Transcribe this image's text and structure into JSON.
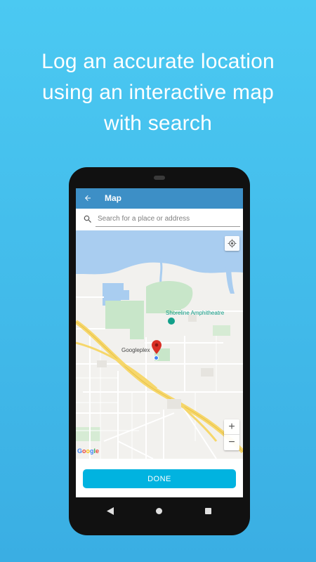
{
  "headline": {
    "line1": "Log an accurate location",
    "line2": "using an interactive map",
    "line3": "with search"
  },
  "appbar": {
    "back_icon": "arrow-left-icon",
    "title": "Map"
  },
  "search": {
    "icon": "search-icon",
    "placeholder": "Search for a place or address",
    "value": ""
  },
  "map": {
    "labels": {
      "shoreline": "Shoreline Amphitheatre",
      "googleplex": "Googleplex"
    },
    "logo": {
      "g1": "G",
      "o1": "o",
      "o2": "o",
      "g2": "g",
      "l": "l",
      "e": "e"
    },
    "controls": {
      "my_location_icon": "crosshair-icon",
      "zoom_in": "+",
      "zoom_out": "−"
    },
    "colors": {
      "water": "#a9cdf0",
      "park": "#c8e6c9",
      "highway": "#f6d76b",
      "road": "#ffffff",
      "pin": "#d93025"
    }
  },
  "done": {
    "label": "DONE"
  },
  "navbar": {
    "back_icon": "triangle-back-icon",
    "home_icon": "circle-home-icon",
    "recents_icon": "square-recents-icon"
  },
  "colors": {
    "background": "#4bc9f2",
    "appbar": "#3d8fc6",
    "accent": "#01b3e0",
    "phone": "#111111"
  }
}
